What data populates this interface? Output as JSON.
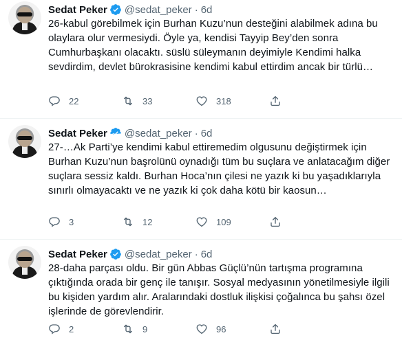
{
  "tweets": [
    {
      "display_name": "Sedat Peker",
      "handle": "@sedat_peker",
      "separator": "·",
      "time": "6d",
      "text": "26-kabul görebilmek için Burhan Kuzu’nun desteğini alabilmek adına bu olaylara olur vermesiydi. Öyle ya, kendisi Tayyip Bey’den sonra Cumhurbaşkanı olacaktı. süslü süleymanın deyimiyle Kendimi halka sevdirdim, devlet bürokrasisine kendimi kabul ettirdim ancak bir türlü…",
      "replies": "22",
      "retweets": "33",
      "likes": "318"
    },
    {
      "display_name": "Sedat Peker",
      "handle": "@sedat_peker",
      "separator": "·",
      "time": "6d",
      "text": "27-…Ak Parti’ye kendimi kabul ettiremedim olgusunu değiştirmek için Burhan Kuzu’nun başrolünü oynadığı tüm bu suçlara ve anlatacağım diğer suçlara sessiz kaldı. Burhan Hoca’nın çilesi ne yazık ki bu yaşadıklarıyla sınırlı olmayacaktı ve ne yazık ki çok daha kötü bir kaosun…",
      "replies": "3",
      "retweets": "12",
      "likes": "109"
    },
    {
      "display_name": "Sedat Peker",
      "handle": "@sedat_peker",
      "separator": "·",
      "time": "6d",
      "text": "28-daha parçası oldu. Bir gün Abbas Güçlü’nün tartışma programına çıktığında orada bir genç ile tanışır. Sosyal medyasının yönetilmesiyle ilgili bu kişiden yardım alır. Aralarındaki dostluk ilişkisi çoğalınca bu şahsı özel işlerinde de görevlendirir.",
      "replies": "2",
      "retweets": "9",
      "likes": "96"
    }
  ],
  "colors": {
    "verified": "#1d9bf0",
    "muted": "#536471",
    "text": "#0f1419",
    "divider": "#eff3f4"
  },
  "icons": [
    "verified-badge-icon",
    "reply-icon",
    "retweet-icon",
    "like-icon",
    "share-icon"
  ]
}
